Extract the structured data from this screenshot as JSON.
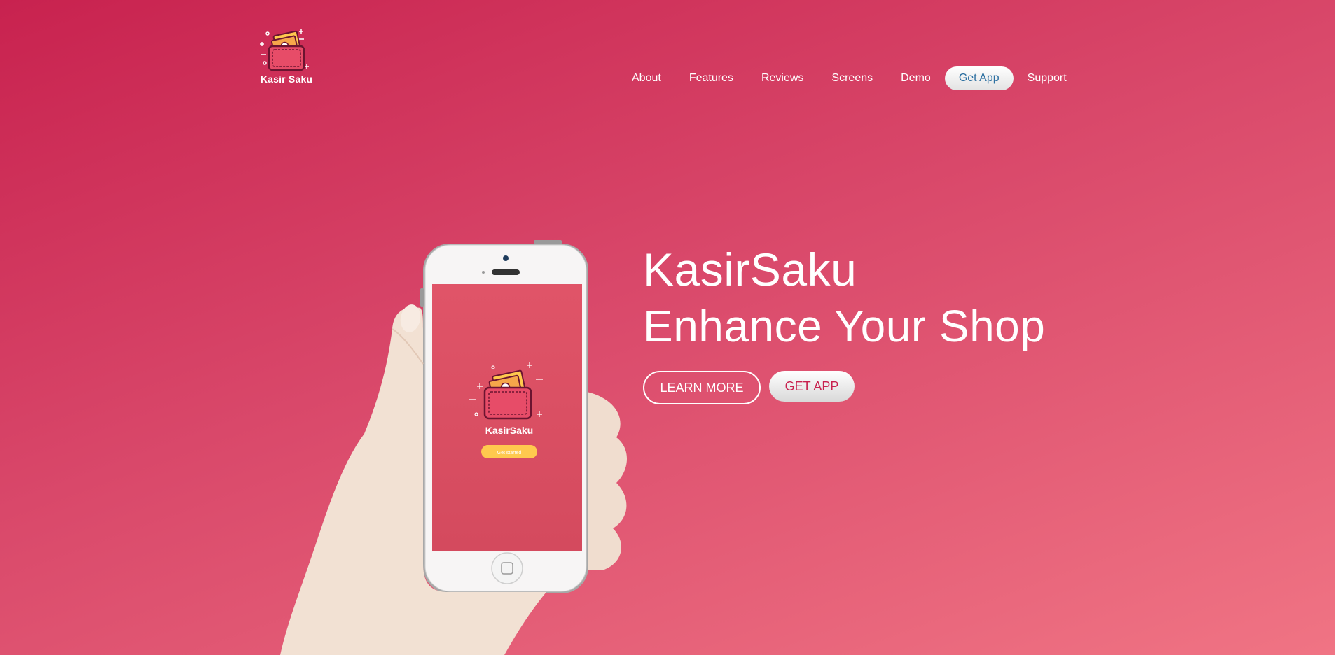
{
  "brand": {
    "name": "Kasir Saku",
    "icon": "wallet-icon"
  },
  "nav": {
    "items": [
      {
        "label": "About"
      },
      {
        "label": "Features"
      },
      {
        "label": "Reviews"
      },
      {
        "label": "Screens"
      },
      {
        "label": "Demo"
      },
      {
        "label": "Get App",
        "highlighted": true
      },
      {
        "label": "Support"
      }
    ]
  },
  "hero": {
    "title": "KasirSaku",
    "subtitle": "Enhance Your Shop",
    "learn_more_label": "LEARN MORE",
    "get_app_label": "GET APP"
  },
  "phone": {
    "app_name": "KasirSaku",
    "button_label": "Get started"
  },
  "colors": {
    "accent": "#c8224f",
    "gradient_end": "#f07484",
    "screen": "#db4b63",
    "phone_button": "#ffc94e"
  }
}
